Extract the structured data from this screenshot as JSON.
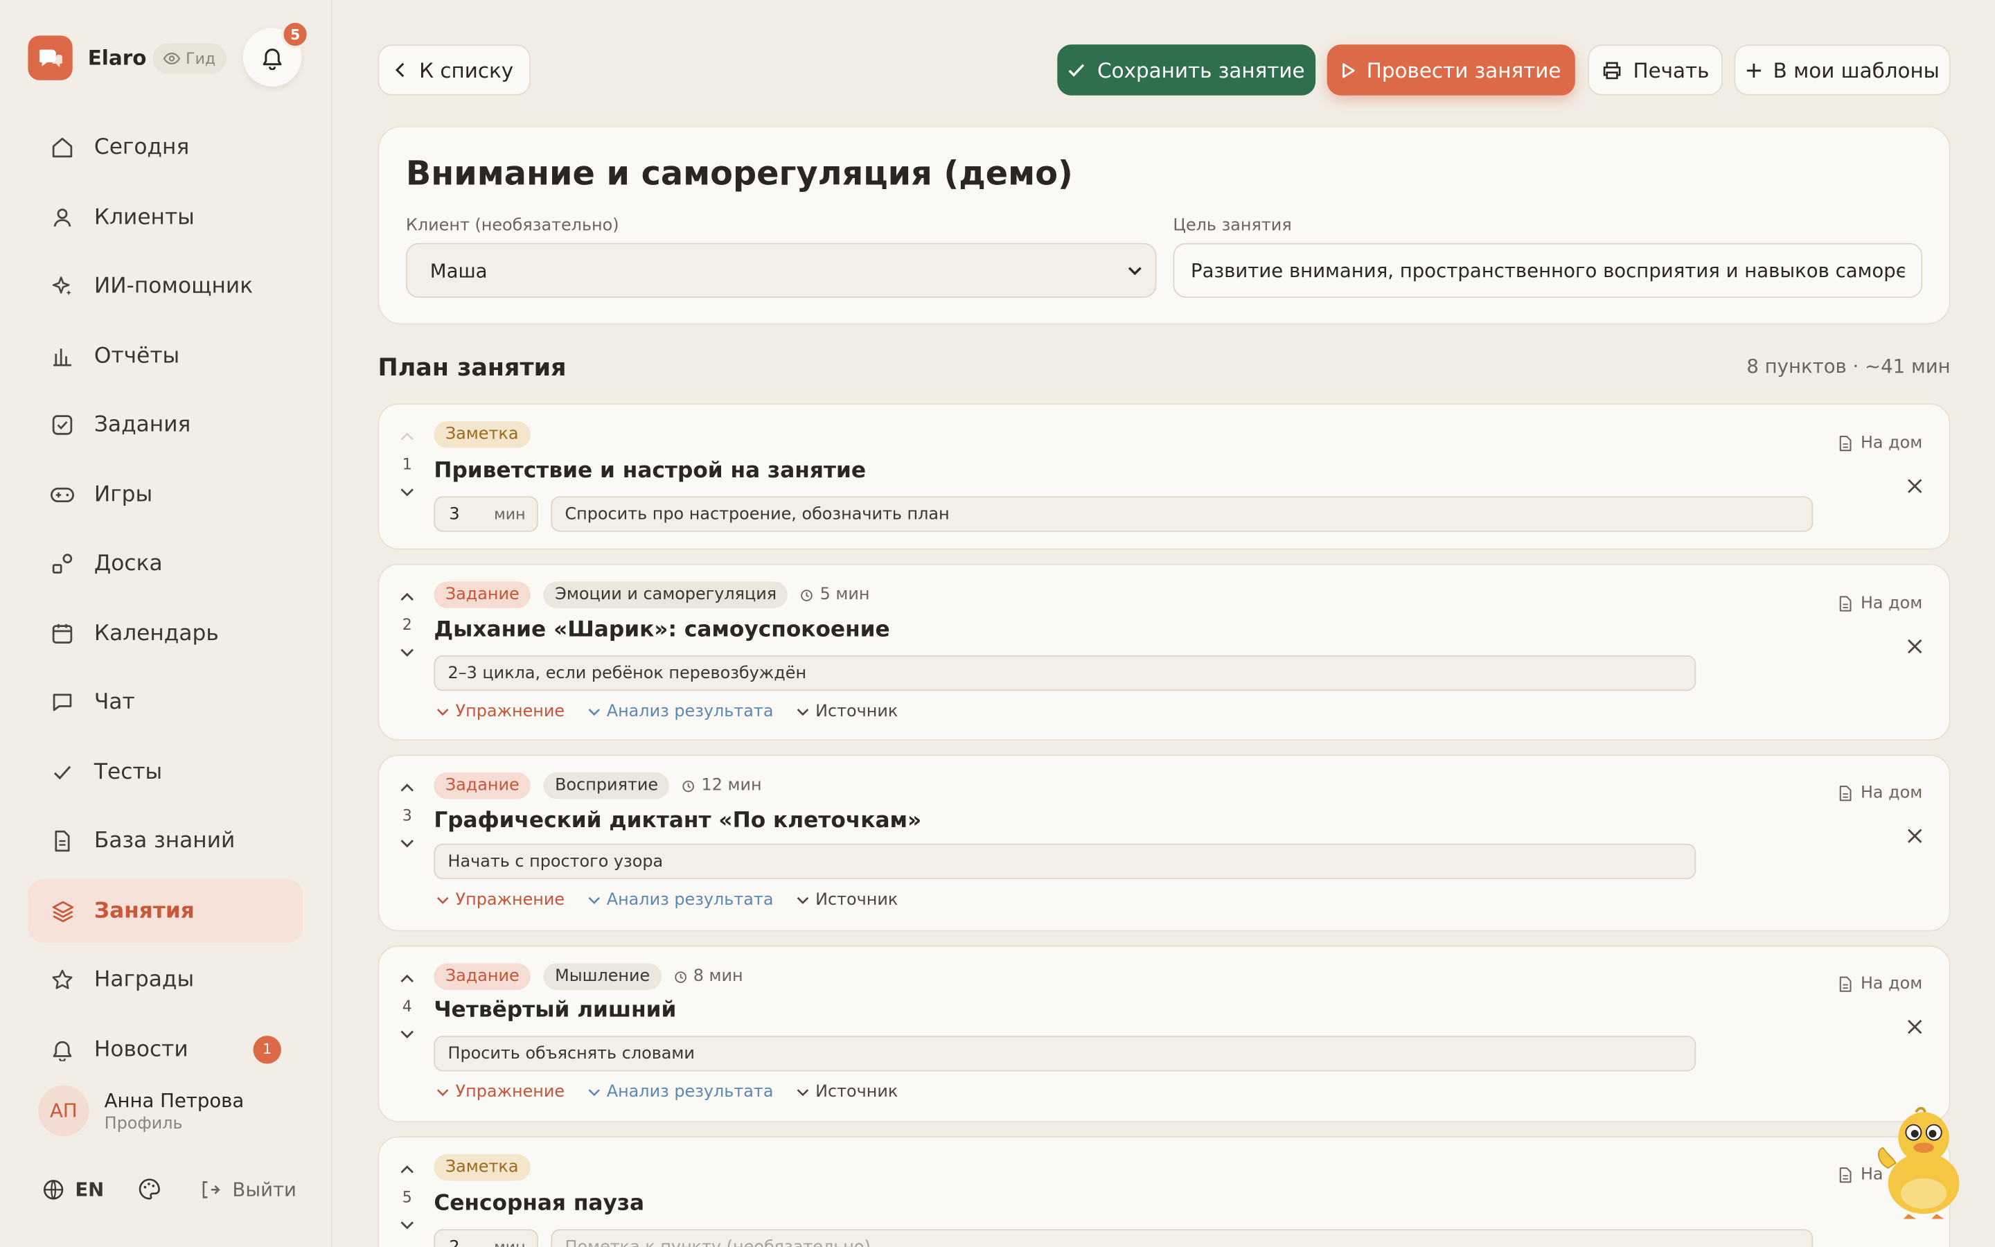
{
  "app": {
    "brand": "Elaro",
    "guide_label": "Гид",
    "notification_count": "5",
    "accent": "#dc6a48",
    "success": "#2f6f4e"
  },
  "sidebar": {
    "items": [
      {
        "label": "Сегодня",
        "icon": "home-icon"
      },
      {
        "label": "Клиенты",
        "icon": "user-icon"
      },
      {
        "label": "ИИ-помощник",
        "icon": "sparkle-icon"
      },
      {
        "label": "Отчёты",
        "icon": "bar-chart-icon"
      },
      {
        "label": "Задания",
        "icon": "checkbox-icon"
      },
      {
        "label": "Игры",
        "icon": "gamepad-icon"
      },
      {
        "label": "Доска",
        "icon": "shapes-icon"
      },
      {
        "label": "Календарь",
        "icon": "calendar-icon"
      },
      {
        "label": "Чат",
        "icon": "chat-icon"
      },
      {
        "label": "Тесты",
        "icon": "check-icon"
      },
      {
        "label": "База знаний",
        "icon": "document-icon"
      },
      {
        "label": "Занятия",
        "icon": "layers-icon",
        "active": true
      },
      {
        "label": "Награды",
        "icon": "star-icon"
      },
      {
        "label": "Новости",
        "icon": "bell-icon",
        "badge": "1"
      }
    ],
    "profile": {
      "initials": "АП",
      "name": "Анна Петрова",
      "sub": "Профиль"
    },
    "lang": "EN",
    "logout": "Выйти"
  },
  "toolbar": {
    "back": "К списку",
    "save": "Сохранить занятие",
    "run": "Провести занятие",
    "print": "Печать",
    "template": "В мои шаблоны"
  },
  "lesson": {
    "title": "Внимание и саморегуляция (демо)",
    "client_label": "Клиент (необязательно)",
    "client_value": "Маша",
    "goal_label": "Цель занятия",
    "goal_value": "Развитие внимания, пространственного восприятия и навыков саморегуляции"
  },
  "plan": {
    "title": "План занятия",
    "meta": "8 пунктов · ~41 мин",
    "home_label": "На дом",
    "links": {
      "exercise": "Упражнение",
      "analysis": "Анализ результата",
      "source": "Источник"
    },
    "unit": "мин",
    "items": [
      {
        "num": "1",
        "type": "Заметка",
        "title": "Приветствие и настрой на занятие",
        "minutes": "3",
        "comment": "Спросить про настроение, обозначить план"
      },
      {
        "num": "2",
        "type": "Задание",
        "category": "Эмоции и саморегуляция",
        "duration": "5 мин",
        "title": "Дыхание «Шарик»: самоуспокоение",
        "comment": "2–3 цикла, если ребёнок перевозбуждён"
      },
      {
        "num": "3",
        "type": "Задание",
        "category": "Восприятие",
        "duration": "12 мин",
        "title": "Графический диктант «По клеточкам»",
        "comment": "Начать с простого узора"
      },
      {
        "num": "4",
        "type": "Задание",
        "category": "Мышление",
        "duration": "8 мин",
        "title": "Четвёртый лишний",
        "comment": "Просить объяснять словами"
      },
      {
        "num": "5",
        "type": "Заметка",
        "title": "Сенсорная пауза",
        "minutes": "2",
        "comment_placeholder": "Пометка к пункту (необязательно)"
      }
    ]
  }
}
